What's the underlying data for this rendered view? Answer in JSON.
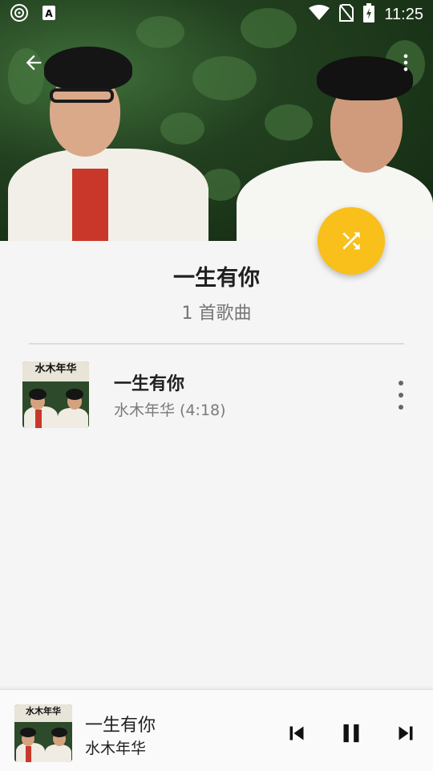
{
  "status_bar": {
    "time": "11:25"
  },
  "playlist": {
    "title": "一生有你",
    "count": "1 首歌曲"
  },
  "songs": [
    {
      "title": "一生有你",
      "subtitle": "水木年华 (4:18)",
      "thumb_text": "水木年华"
    }
  ],
  "mini_player": {
    "title": "一生有你",
    "artist": "水木年华",
    "thumb_text": "水木年华"
  },
  "colors": {
    "accent": "#f9bf1a",
    "background": "#f5f5f5"
  },
  "icons": [
    "back-arrow-icon",
    "more-vert-icon",
    "shuffle-icon",
    "skip-previous-icon",
    "pause-icon",
    "skip-next-icon"
  ]
}
